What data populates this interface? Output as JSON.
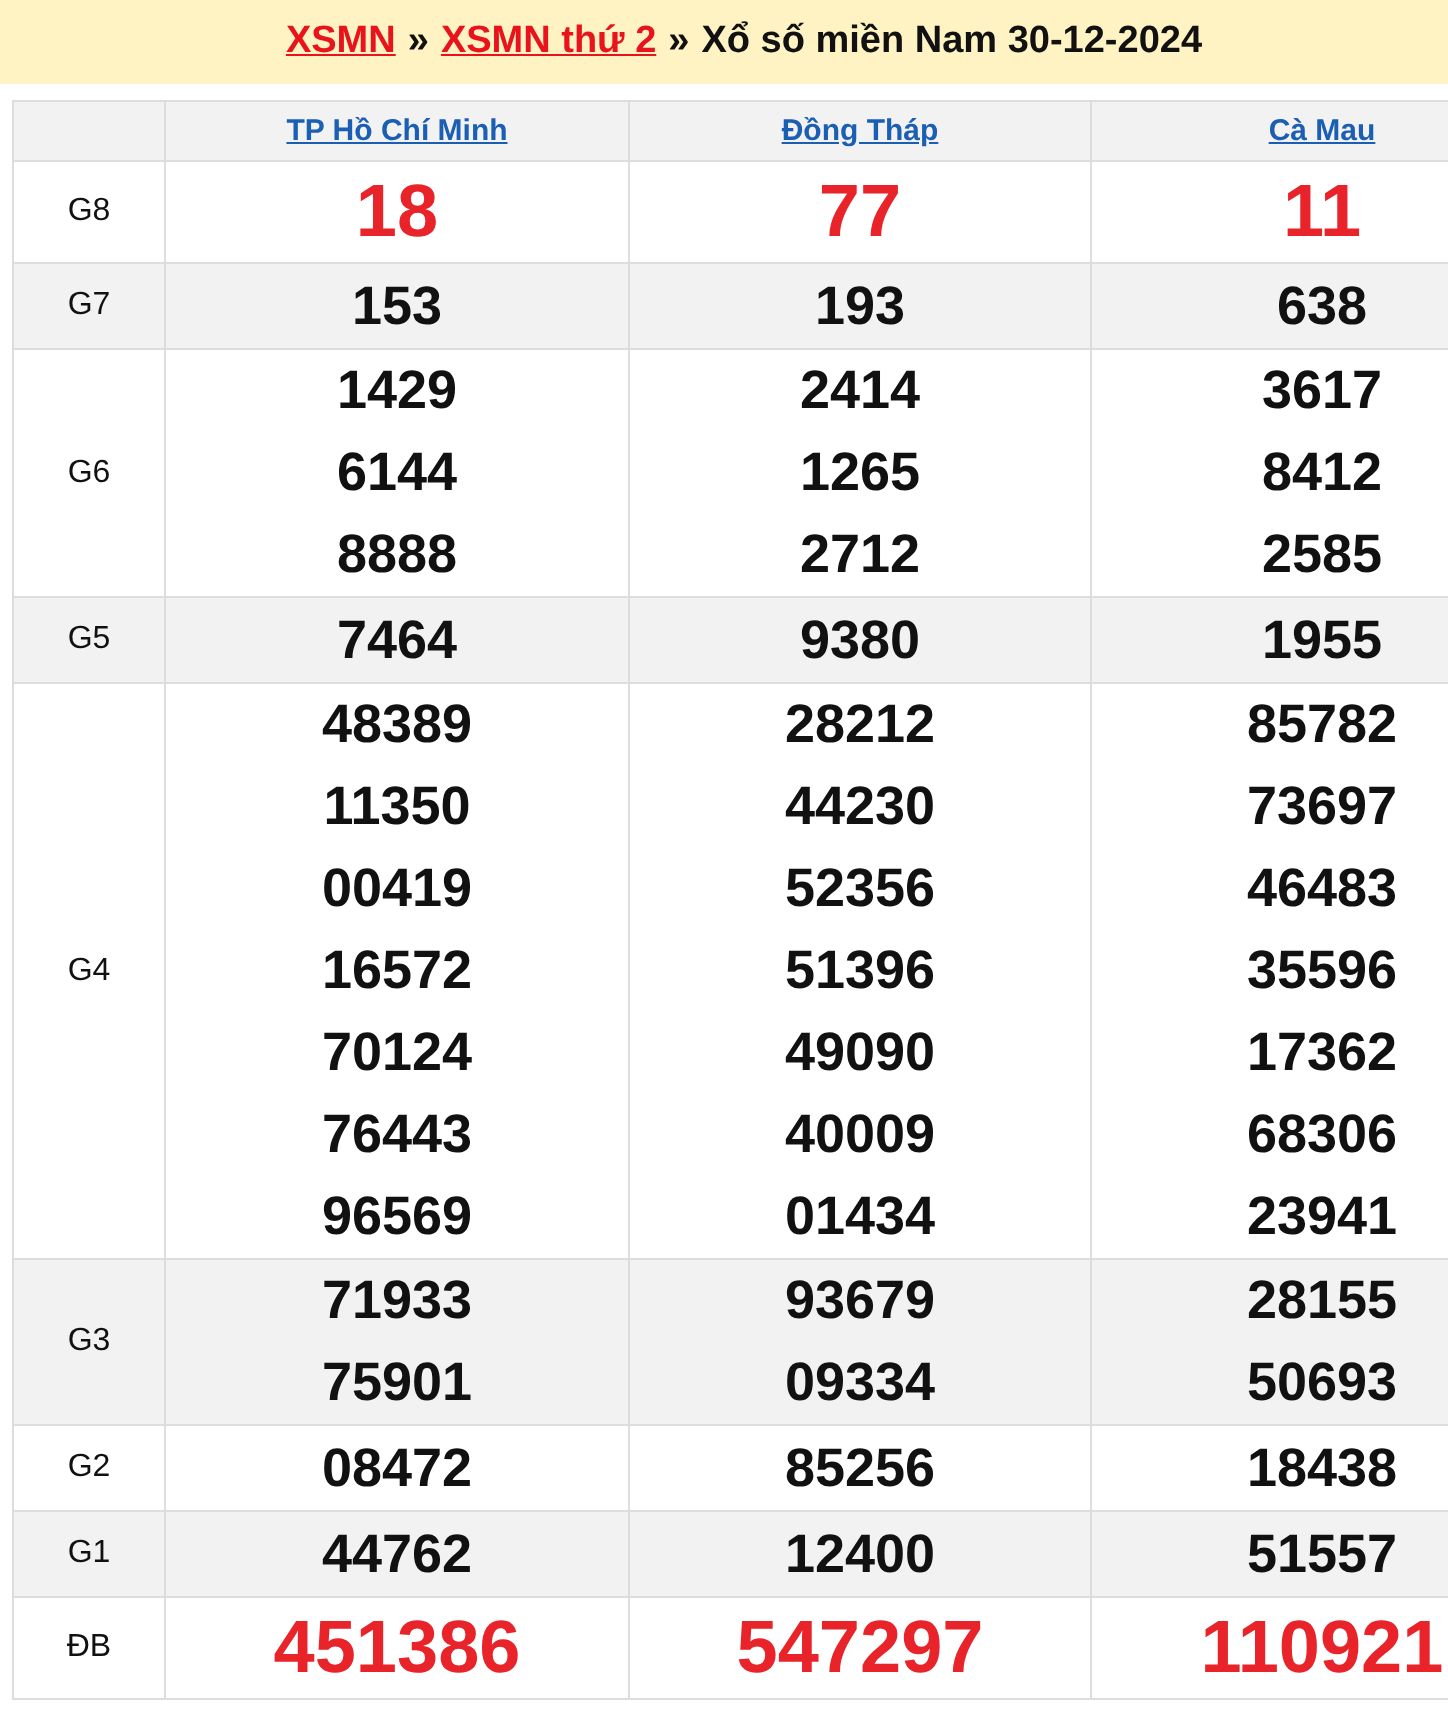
{
  "title": {
    "links": [
      "XSMN",
      "XSMN thứ 2"
    ],
    "separator": "»",
    "text": "Xổ số miền Nam 30-12-2024"
  },
  "columns": [
    "TP Hồ Chí Minh",
    "Đồng Tháp",
    "Cà Mau"
  ],
  "rows": [
    {
      "label": "G8",
      "kind": "big",
      "shaded": false,
      "cells": [
        [
          "18"
        ],
        [
          "77"
        ],
        [
          "11"
        ]
      ]
    },
    {
      "label": "G7",
      "kind": "normal",
      "shaded": true,
      "cells": [
        [
          "153"
        ],
        [
          "193"
        ],
        [
          "638"
        ]
      ]
    },
    {
      "label": "G6",
      "kind": "normal",
      "shaded": false,
      "cells": [
        [
          "1429",
          "6144",
          "8888"
        ],
        [
          "2414",
          "1265",
          "2712"
        ],
        [
          "3617",
          "8412",
          "2585"
        ]
      ]
    },
    {
      "label": "G5",
      "kind": "normal",
      "shaded": true,
      "cells": [
        [
          "7464"
        ],
        [
          "9380"
        ],
        [
          "1955"
        ]
      ]
    },
    {
      "label": "G4",
      "kind": "normal",
      "shaded": false,
      "cells": [
        [
          "48389",
          "11350",
          "00419",
          "16572",
          "70124",
          "76443",
          "96569"
        ],
        [
          "28212",
          "44230",
          "52356",
          "51396",
          "49090",
          "40009",
          "01434"
        ],
        [
          "85782",
          "73697",
          "46483",
          "35596",
          "17362",
          "68306",
          "23941"
        ]
      ]
    },
    {
      "label": "G3",
      "kind": "normal",
      "shaded": true,
      "cells": [
        [
          "71933",
          "75901"
        ],
        [
          "93679",
          "09334"
        ],
        [
          "28155",
          "50693"
        ]
      ]
    },
    {
      "label": "G2",
      "kind": "normal",
      "shaded": false,
      "cells": [
        [
          "08472"
        ],
        [
          "85256"
        ],
        [
          "18438"
        ]
      ]
    },
    {
      "label": "G1",
      "kind": "normal",
      "shaded": true,
      "cells": [
        [
          "44762"
        ],
        [
          "12400"
        ],
        [
          "51557"
        ]
      ]
    },
    {
      "label": "ĐB",
      "kind": "big",
      "shaded": false,
      "cells": [
        [
          "451386"
        ],
        [
          "547297"
        ],
        [
          "110921"
        ]
      ]
    }
  ]
}
